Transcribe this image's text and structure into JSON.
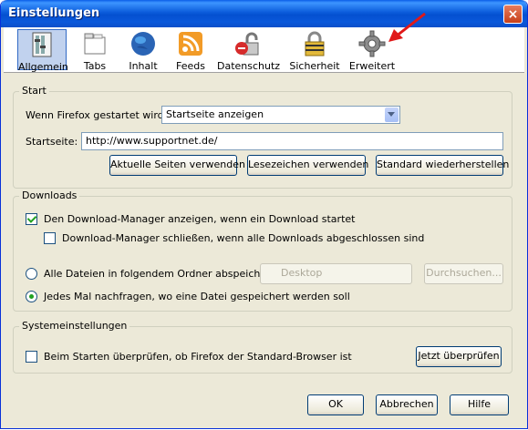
{
  "window": {
    "title": "Einstellungen",
    "close": "×"
  },
  "toolbar": {
    "items": [
      {
        "label": "Allgemein",
        "icon": "general-icon",
        "selected": true
      },
      {
        "label": "Tabs",
        "icon": "tabs-icon"
      },
      {
        "label": "Inhalt",
        "icon": "globe-icon"
      },
      {
        "label": "Feeds",
        "icon": "rss-feed-icon"
      },
      {
        "label": "Datenschutz",
        "icon": "privacy-lock-icon"
      },
      {
        "label": "Sicherheit",
        "icon": "security-padlock-icon"
      },
      {
        "label": "Erweitert",
        "icon": "gear-icon"
      }
    ]
  },
  "start": {
    "group_title": "Start",
    "startup_label": "Wenn Firefox gestartet wird:",
    "startup_value": "Startseite anzeigen",
    "homepage_label": "Startseite:",
    "homepage_value": "http://www.supportnet.de/",
    "btn_current": "Aktuelle Seiten verwenden",
    "btn_bookmark": "Lesezeichen verwenden",
    "btn_restore": "Standard wiederherstellen"
  },
  "downloads": {
    "group_title": "Downloads",
    "show_manager": "Den Download-Manager anzeigen, wenn ein Download startet",
    "close_manager": "Download-Manager schließen, wenn alle Downloads abgeschlossen sind",
    "save_folder": "Alle Dateien in folgendem Ordner abspeichern:",
    "folder_value": "Desktop",
    "browse": "Durchsuchen...",
    "ask_every": "Jedes Mal nachfragen, wo eine Datei gespeichert werden soll"
  },
  "system": {
    "group_title": "Systemeinstellungen",
    "check_default": "Beim Starten überprüfen, ob Firefox der Standard-Browser ist",
    "check_now": "Jetzt überprüfen"
  },
  "footer": {
    "ok": "OK",
    "cancel": "Abbrechen",
    "help": "Hilfe"
  }
}
